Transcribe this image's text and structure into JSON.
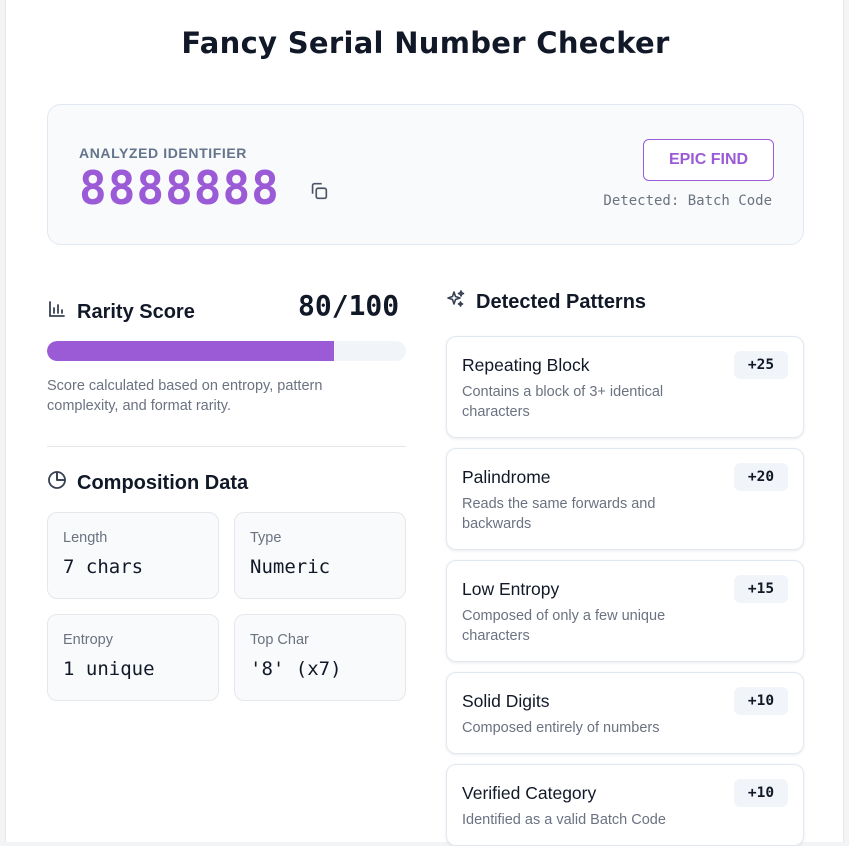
{
  "app": {
    "title": "Fancy Serial Number Checker"
  },
  "hero": {
    "label": "ANALYZED IDENTIFIER",
    "value": "8888888",
    "badge": "EPIC FIND",
    "detected": "Detected: Batch Code",
    "accent_color": "#9b5bd6"
  },
  "rarity": {
    "heading": "Rarity Score",
    "score_text": "80/100",
    "score_fraction": 0.8,
    "note": "Score calculated based on entropy, pattern complexity, and format rarity."
  },
  "composition": {
    "heading": "Composition Data",
    "cards": [
      {
        "label": "Length",
        "value": "7 chars"
      },
      {
        "label": "Type",
        "value": "Numeric"
      },
      {
        "label": "Entropy",
        "value": "1 unique"
      },
      {
        "label": "Top Char",
        "value": "'8' (x7)"
      }
    ]
  },
  "patterns": {
    "heading": "Detected Patterns",
    "items": [
      {
        "title": "Repeating Block",
        "desc": "Contains a block of 3+ identical characters",
        "points": "+25"
      },
      {
        "title": "Palindrome",
        "desc": "Reads the same forwards and backwards",
        "points": "+20"
      },
      {
        "title": "Low Entropy",
        "desc": "Composed of only a few unique characters",
        "points": "+15"
      },
      {
        "title": "Solid Digits",
        "desc": "Composed entirely of numbers",
        "points": "+10"
      },
      {
        "title": "Verified Category",
        "desc": "Identified as a valid Batch Code",
        "points": "+10"
      }
    ]
  },
  "icons": {
    "copy": "copy-icon",
    "rarity": "bar-chart-icon",
    "composition": "pie-chart-icon",
    "patterns": "sparkles-icon"
  }
}
